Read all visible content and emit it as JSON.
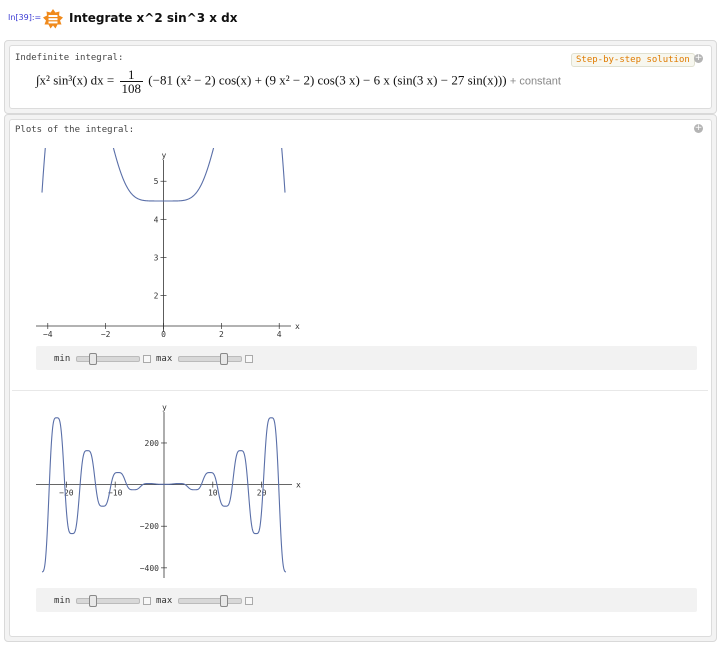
{
  "input": {
    "prompt_label": "In[39]:=",
    "query": "Integrate x^2 sin^3 x dx"
  },
  "pods": {
    "indefinite": {
      "title": "Indefinite integral:",
      "step_button": "Step-by-step solution",
      "lhs": "∫x² sin³(x) dx =",
      "frac_num": "1",
      "frac_den": "108",
      "rhs": "(−81 (x² − 2) cos(x) + (9 x² − 2) cos(3 x) − 6 x (sin(3 x) − 27 sin(x)))",
      "constant": "+ constant"
    },
    "plots": {
      "title": "Plots of the integral:",
      "controls": {
        "min_label": "min",
        "max_label": "max"
      }
    }
  },
  "chart_data": [
    {
      "type": "line",
      "xlabel": "x",
      "ylabel": "y",
      "xlim": [
        -4.2,
        4.2
      ],
      "ylim": [
        1.2,
        5.4
      ],
      "xticks": [
        -4,
        -2,
        0,
        2,
        4
      ],
      "yticks": [
        2,
        3,
        4,
        5
      ],
      "series": [
        {
          "function": "x^2 sin^3(x) antiderivative + C",
          "x_range": [
            -4.2,
            4.2
          ],
          "color": "#5a6fa8"
        }
      ]
    },
    {
      "type": "line",
      "xlabel": "x",
      "ylabel": "y",
      "xlim": [
        -25.0,
        25.0
      ],
      "ylim": [
        -420,
        320
      ],
      "xticks": [
        -20,
        -10,
        10,
        20
      ],
      "yticks": [
        -400,
        -200,
        200
      ],
      "series": [
        {
          "function": "x^2 sin^3(x) antiderivative",
          "x_range": [
            -25.0,
            25.0
          ],
          "color": "#5a6fa8"
        }
      ]
    }
  ]
}
